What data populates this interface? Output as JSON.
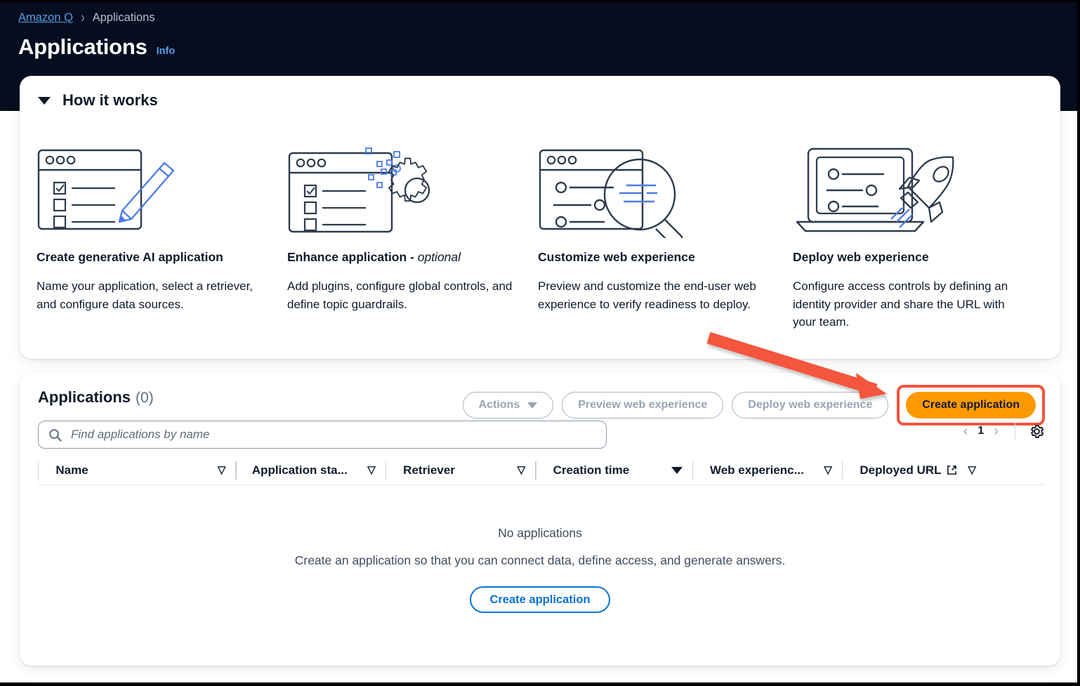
{
  "header": {
    "breadcrumb": {
      "root": "Amazon Q",
      "separator": "›",
      "current": "Applications"
    },
    "title": "Applications",
    "info_link": "Info"
  },
  "how_it_works": {
    "section_title": "How it works",
    "steps": [
      {
        "icon": "browser-checklist-pencil-icon",
        "heading": "Create generative AI application",
        "heading_suffix": "",
        "description": "Name your application, select a retriever, and configure data sources."
      },
      {
        "icon": "browser-checklist-gear-icon",
        "heading": "Enhance application - ",
        "heading_suffix": "optional",
        "description": "Add plugins, configure global controls, and define topic guardrails."
      },
      {
        "icon": "browser-settings-magnifier-icon",
        "heading": "Customize web experience",
        "heading_suffix": "",
        "description": "Preview and customize the end-user web experience to verify readiness to deploy."
      },
      {
        "icon": "laptop-rocket-icon",
        "heading": "Deploy web experience",
        "heading_suffix": "",
        "description": "Configure access controls by defining an identity provider and share the URL with your team."
      }
    ]
  },
  "applications_panel": {
    "title": "Applications",
    "count": "(0)",
    "toolbar": {
      "actions_label": "Actions",
      "preview_label": "Preview web experience",
      "deploy_label": "Deploy web experience",
      "create_label": "Create application"
    },
    "search": {
      "placeholder": "Find applications by name",
      "value": ""
    },
    "pagination": {
      "prev": "‹",
      "page": "1",
      "next": "›"
    },
    "settings_icon": "gear-icon",
    "columns": [
      {
        "label": "Name",
        "sort": "hollow"
      },
      {
        "label": "Application sta...",
        "sort": "hollow"
      },
      {
        "label": "Retriever",
        "sort": "hollow"
      },
      {
        "label": "Creation time",
        "sort": "filled"
      },
      {
        "label": "Web experienc...",
        "sort": "hollow"
      },
      {
        "label": "Deployed URL",
        "sort": "hollow",
        "external": true
      }
    ],
    "empty_state": {
      "title": "No applications",
      "description": "Create an application so that you can connect data, define access, and generate answers.",
      "button_label": "Create application"
    }
  },
  "annotation": {
    "type": "arrow",
    "color": "#f4543c",
    "points_to": "create-application-button",
    "highlight_color": "#f4543c"
  },
  "colors": {
    "header_bg": "#050d1f",
    "link": "#539fe5",
    "primary_button": "#ff9900",
    "outline_blue": "#0972d3",
    "annotation_red": "#f4543c"
  }
}
